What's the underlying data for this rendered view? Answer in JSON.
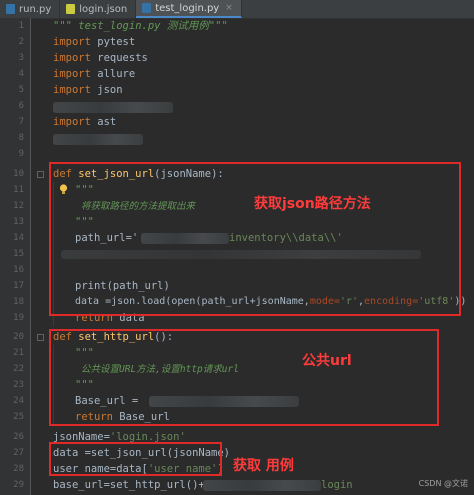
{
  "tabs": [
    {
      "label": "run.py",
      "icon": "python-file-icon",
      "color": "#3572a5",
      "active": false
    },
    {
      "label": "login.json",
      "icon": "json-file-icon",
      "color": "#cbcb41",
      "active": false
    },
    {
      "label": "test_login.py",
      "icon": "python-file-icon",
      "color": "#3572a5",
      "active": true
    }
  ],
  "tab_close_glyph": "×",
  "line_numbers": [
    "1",
    "2",
    "3",
    "4",
    "5",
    "6",
    "7",
    "8",
    "9",
    "10",
    "11",
    "12",
    "13",
    "14",
    "15",
    "16",
    "17",
    "18",
    "19",
    "20",
    "21",
    "22",
    "23",
    "24",
    "25",
    "26",
    "27",
    "28",
    "29"
  ],
  "code": {
    "l1_open": "\"\"\" ",
    "l1_title": "test_login.py",
    "l1_desc": " 测试用例\"\"\"",
    "import_kw": "import",
    "import_pytest": " pytest",
    "import_requests": " requests",
    "import_allure": " allure",
    "import_json": " json",
    "import_ast": " ast",
    "def_kw": "def",
    "fn1_name": " set_json_url",
    "fn1_params_open": "(",
    "fn1_param": "jsonName",
    "fn1_params_close": "):",
    "doc_quotes": "\"\"\"",
    "doc1_text": "将获取路径的方法提取出来",
    "path_assign": "path_url='",
    "path_tail": "inventory\\\\data\\\\'",
    "print_line": "print(path_url)",
    "data_line_start": "data =",
    "data_json": "json",
    "data_line_mid": ".load(open(path_url+jsonName,",
    "mode_kw": "mode=",
    "mode_val": "'r'",
    "comma": ",",
    "enc_kw": "encoding=",
    "enc_val": "'utf8'",
    "data_line_end": "))",
    "return_kw": "return",
    "return1_val": " data",
    "fn2_name": " set_http_url",
    "fn2_params": "():",
    "doc2_text": "公共设置URL方法,设置http请求url",
    "base_assign": "Base_url = ",
    "return2_val": " Base_url",
    "jsonname_assign": "jsonName=",
    "jsonname_val": "'login.json'",
    "data_call": "data =set_json_url(jsonName)",
    "username_start": "user_name=data[",
    "username_key": "'user_name'",
    "username_end": "]",
    "baseurl_call": "base_url=set_http_url()+",
    "login_str": "login"
  },
  "annotations": {
    "box1": "获取json路径方法",
    "box2": "公共url",
    "box3": "获取 用例"
  },
  "watermark": "CSDN @文诺",
  "colors": {
    "keyword": "#cc7832",
    "function": "#ffc66d",
    "string": "#6a8759",
    "docstring": "#629755",
    "annotation_red": "#e02a2a"
  }
}
